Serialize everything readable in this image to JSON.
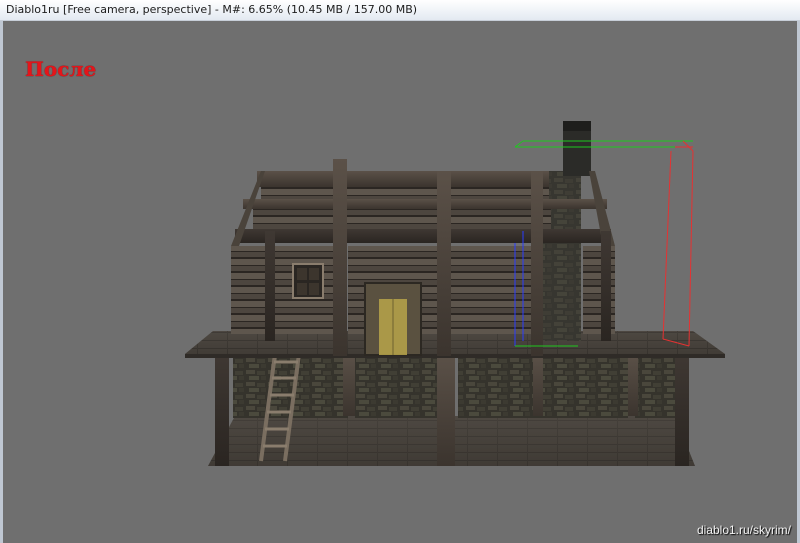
{
  "window": {
    "title": "Diablo1ru [Free camera, perspective] - M#: 6.65% (10.45 MB / 157.00 MB)"
  },
  "viewport": {
    "overlay_label": "После",
    "watermark": "diablo1.ru/skyrim/",
    "colors": {
      "background": "#6f6f6f",
      "label": "#e5141a",
      "gizmo_x": "#e53232",
      "gizmo_y": "#1ec81e",
      "gizmo_z": "#2a3cff"
    }
  },
  "scene": {
    "object": "wooden-house-model",
    "selection": "chimney-bounding-box"
  }
}
